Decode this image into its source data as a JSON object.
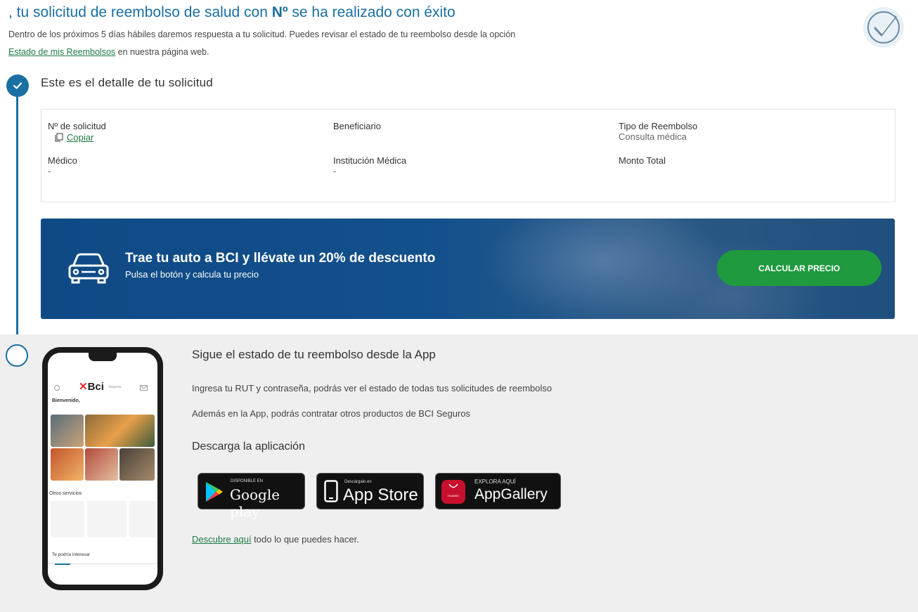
{
  "header": {
    "title_pre": ", tu solicitud de reembolso de salud con ",
    "title_bold": "Nº",
    "title_post": " se ha realizado con éxito",
    "intro_line1": "Dentro de los próximos 5 días hábiles daremos respuesta a tu solicitud. Puedes revisar el estado de tu reembolso desde la opción",
    "intro_link": "Estado de mis Reembolsos",
    "intro_line2": " en nuestra página web."
  },
  "detail": {
    "heading": "Este es el detalle de tu solicitud",
    "fields": {
      "solicitud_label": "Nº de solicitud",
      "copy_label": "Copiar",
      "beneficiario_label": "Beneficiario",
      "tipo_label": "Tipo de Reembolso",
      "tipo_value": "Consulta médica",
      "medico_label": "Médico",
      "medico_value": "-",
      "institucion_label": "Institución Médica",
      "institucion_value": "-",
      "monto_label": "Monto Total"
    }
  },
  "promo": {
    "title": "Trae tu auto a BCI y llévate un 20% de descuento",
    "subtitle": "Pulsa el botón y calcula tu precio",
    "cta": "CALCULAR PRECIO"
  },
  "app": {
    "heading": "Sigue el estado de tu reembolso desde la App",
    "line1": "Ingresa tu RUT y contraseña, podrás ver el estado de todas tus solicitudes de reembolso",
    "line2": "Además en la App, podrás contratar otros productos de BCI Seguros",
    "download_heading": "Descarga la aplicación",
    "stores": {
      "google_small": "DISPONIBLE EN",
      "google_big": "Google play",
      "apple_small": "Descárgalo en",
      "apple_big": "App Store",
      "huawei_small": "EXPLORA AQUÍ",
      "huawei_big": "AppGallery",
      "huawei_brand": "HUAWEI"
    },
    "discover_link": "Descubre aquí",
    "discover_rest": " todo lo que puedes hacer."
  },
  "phone_mock": {
    "brand": "Bci",
    "brand_sub": "Seguros",
    "welcome": "Bienvenido,",
    "otros": "Otros servicios",
    "interesar": "Te podría interesar"
  },
  "colors": {
    "primary_blue": "#1a6fa3",
    "link_green": "#1e7a43",
    "cta_green": "#1f9a3e",
    "banner_blue": "#0f4a85"
  }
}
